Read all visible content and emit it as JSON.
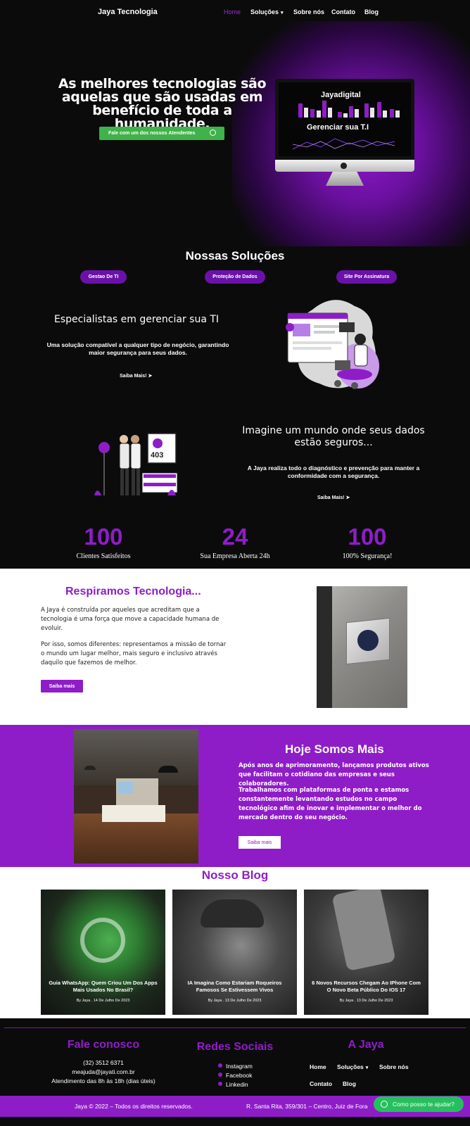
{
  "nav": {
    "brand": "Jaya Tecnologia",
    "items": [
      "Home",
      "Soluções",
      "Sobre nós",
      "Contato",
      "Blog"
    ]
  },
  "hero": {
    "title": "As melhores tecnologias são aquelas que são usadas em benefício de toda a humanidade.",
    "cta": "Fale com um dos nossos Atendentes",
    "screen_title": "Jayadigital",
    "screen_subtitle": "Gerenciar sua T.I"
  },
  "solutions": {
    "title": "Nossas Soluções",
    "pills": [
      "Gestao De TI",
      "Proteção de Dados",
      "Site Por Assinatura"
    ],
    "block1": {
      "heading": "Especialistas em gerenciar sua TI",
      "text": "Uma solução compatível a qualquer tipo de negócio, garantindo maior segurança para seus dados.",
      "more": "Saiba Mais!"
    },
    "block2": {
      "heading": "Imagine um mundo onde seus dados estão seguros...",
      "text": "A Jaya realiza todo o diagnóstico e prevenção para manter a conformidade com a segurança.",
      "more": "Saiba Mais!",
      "sign_text": "403"
    }
  },
  "stats": [
    {
      "value": "100",
      "label": "Clientes Satisfeitos"
    },
    {
      "value": "24",
      "label": "Sua Empresa Aberta 24h"
    },
    {
      "value": "100",
      "label": "100% Segurança!"
    }
  ],
  "about": {
    "title": "Respiramos Tecnologia...",
    "p1": "A Jaya é construída por aqueles que acreditam que a tecnologia é uma força que move a capacidade humana de evoluir.",
    "p2": "Por isso, somos diferentes: representamos a missão de tornar o mundo um lugar melhor, mais seguro e inclusivo através daquilo que fazemos de melhor.",
    "button": "Saiba mais"
  },
  "today": {
    "title": "Hoje Somos Mais",
    "p1": "Após anos de aprimoramento, lançamos produtos ativos que facilitam o cotidiano das empresas e seus colaboradores.",
    "p2": "Trabalhamos com plataformas de ponta e estamos constantemente levantando estudos no campo tecnológico afim de inovar e implementar o melhor do mercado dentro do seu negócio.",
    "button": "Saiba mais"
  },
  "blog": {
    "title": "Nosso Blog",
    "posts": [
      {
        "title": "Guia WhatsApp: Quem Criou Um Dos Apps Mais Usados No Brasil?",
        "meta": "By Jaya . 14 De Julho De 2023"
      },
      {
        "title": "IA Imagina Como Estariam Roqueiros Famosos Se Estivessem Vivos",
        "meta": "By Jaya . 13 De Julho De 2023"
      },
      {
        "title": "6 Novos Recursos Chegam Ao IPhone Com O Novo Beta Público Do IOS 17",
        "meta": "By Jaya . 13 De Julho De 2023"
      }
    ]
  },
  "footer": {
    "contact_title": "Fale conosco",
    "phone": "(32) 3512 6371",
    "email": "meajuda@jayati.com.br",
    "hours": "Atendimento das 8h às 18h (dias úteis)",
    "social_title": "Redes Sociais",
    "social": [
      "Instagram",
      "Facebook",
      "Linkedin"
    ],
    "jaya_title": "A Jaya",
    "links": [
      "Home",
      "Soluções",
      "Sobre nós",
      "Contato",
      "Blog"
    ],
    "copyright": "Jaya © 2022 – Todos os direitos reservados.",
    "address": "R. Santa Rita, 359/301 – Centro, Juiz de Fora",
    "chat": "Como posso te ajudar?"
  },
  "colors": {
    "accent": "#8e1dc8",
    "cta": "#3fb24a",
    "chat": "#25c05e"
  }
}
